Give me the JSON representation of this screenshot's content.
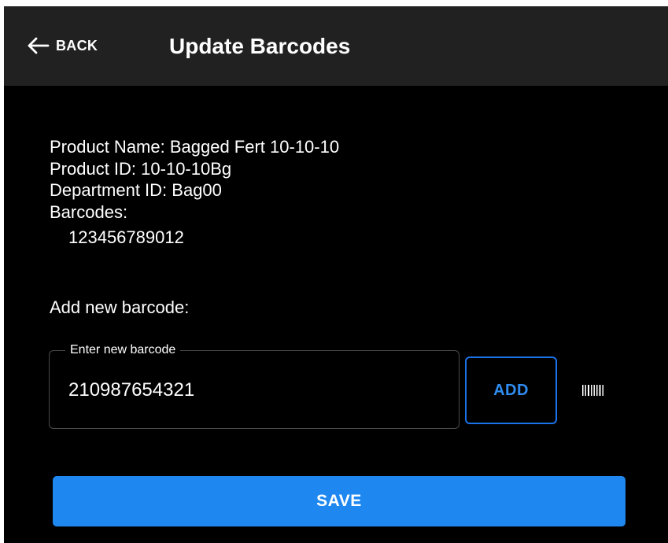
{
  "header": {
    "back_label": "BACK",
    "back_icon": "arrow-left-icon",
    "title": "Update Barcodes"
  },
  "product": {
    "name_line": "Product Name: Bagged Fert 10-10-10",
    "id_line": "Product ID: 10-10-10Bg",
    "department_line": "Department ID: Bag00",
    "barcodes_label": "Barcodes:",
    "barcodes": [
      "123456789012"
    ]
  },
  "add_section": {
    "heading": "Add new barcode:",
    "field_label": "Enter new barcode",
    "field_value": "210987654321",
    "add_label": "ADD",
    "scan_icon": "barcode-scan-icon"
  },
  "footer": {
    "save_label": "SAVE"
  },
  "colors": {
    "background": "#000000",
    "appbar": "#212121",
    "accent": "#1e88f0",
    "text": "#ffffff"
  }
}
